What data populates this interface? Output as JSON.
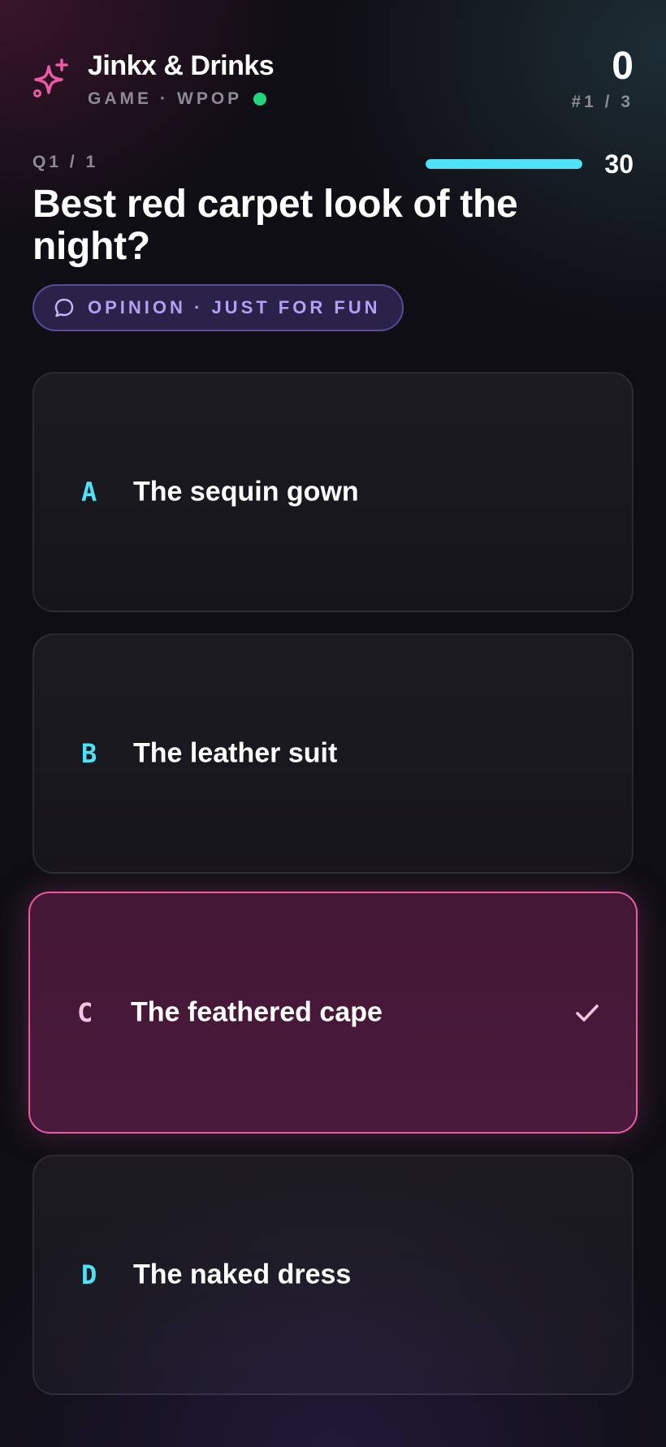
{
  "header": {
    "title": "Jinkx & Drinks",
    "subtitle_mode": "GAME",
    "subtitle_separator": "·",
    "subtitle_code": "WPOP",
    "live_status_color": "#22d47a",
    "score": "0",
    "rank": "#1 / 3",
    "brand_icon": "sparkle-icon"
  },
  "question": {
    "counter": "Q1 / 1",
    "timer_value": "30",
    "timer_progress": 1.0,
    "text": "Best red carpet look of the night?",
    "tag_icon": "chat-bubble-icon",
    "tag": "OPINION · JUST FOR FUN"
  },
  "options": [
    {
      "letter": "A",
      "text": "The sequin gown",
      "selected": false
    },
    {
      "letter": "B",
      "text": "The leather suit",
      "selected": false
    },
    {
      "letter": "C",
      "text": "The feathered cape",
      "selected": true
    },
    {
      "letter": "D",
      "text": "The naked dress",
      "selected": false
    }
  ],
  "colors": {
    "accent_cyan": "#4fe1f5",
    "accent_pink": "#ec5aa4",
    "pill_purple": "#b59ff5",
    "muted_text": "#8c8b93"
  }
}
